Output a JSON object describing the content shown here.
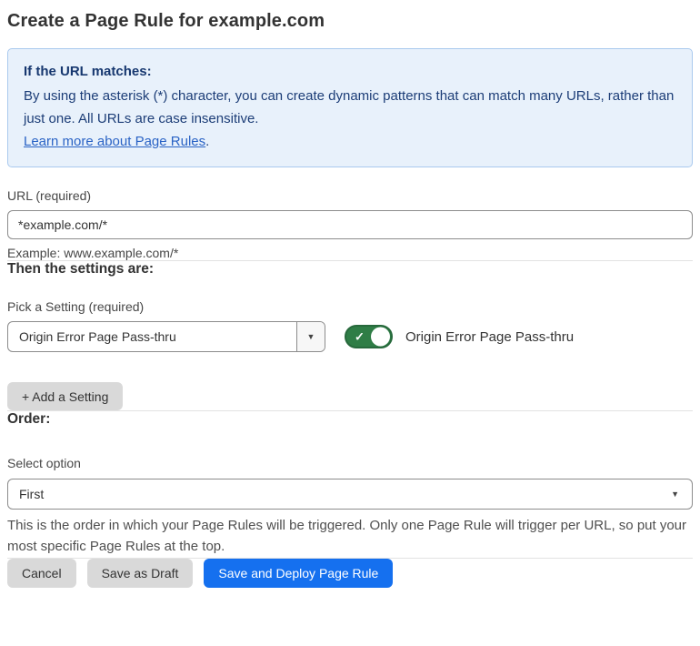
{
  "page": {
    "title": "Create a Page Rule for example.com"
  },
  "info_box": {
    "heading": "If the URL matches:",
    "body": "By using the asterisk (*) character, you can create dynamic patterns that can match many URLs, rather than just one. All URLs are case insensitive.",
    "link_label": "Learn more about Page Rules",
    "link_suffix": "."
  },
  "url_field": {
    "label": "URL (required)",
    "value": "*example.com/*",
    "helper": "Example: www.example.com/*"
  },
  "settings_section": {
    "heading": "Then the settings are:",
    "picker_label": "Pick a Setting (required)",
    "picker_value": "Origin Error Page Pass-thru",
    "toggle_label": "Origin Error Page Pass-thru",
    "toggle_state": "on",
    "add_setting_label": "+ Add a Setting"
  },
  "order_section": {
    "heading": "Order:",
    "select_label": "Select option",
    "select_value": "First",
    "helper": "This is the order in which your Page Rules will be triggered. Only one Page Rule will trigger per URL, so put your most specific Page Rules at the top."
  },
  "footer": {
    "cancel_label": "Cancel",
    "save_draft_label": "Save as Draft",
    "save_deploy_label": "Save and Deploy Page Rule"
  },
  "icons": {
    "dropdown_arrow": "▼",
    "toggle_check": "✓"
  },
  "colors": {
    "info_box_bg": "#e8f1fb",
    "info_box_border": "#a9c9ee",
    "info_text": "#1c3d77",
    "link_blue": "#2a63c5",
    "toggle_green": "#2f7d46",
    "primary_button_blue": "#1570ef",
    "gray_button": "#d9d9d9",
    "divider": "#e3e3e3"
  }
}
